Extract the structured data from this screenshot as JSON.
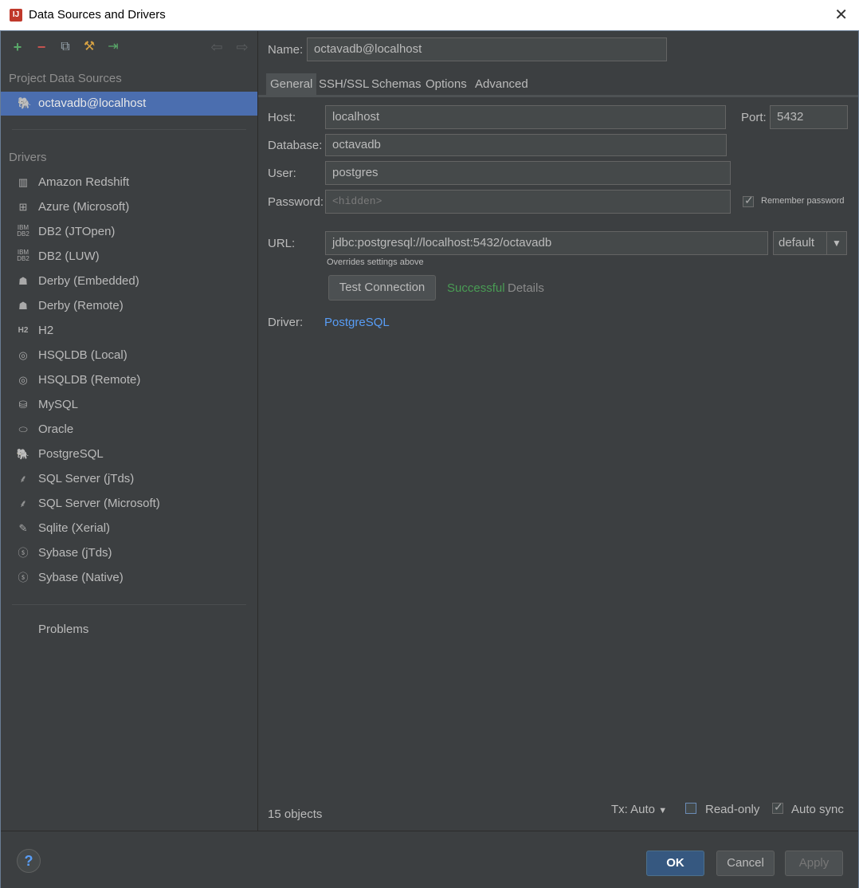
{
  "window": {
    "title": "Data Sources and Drivers"
  },
  "toolbar": {
    "icons": [
      "add-icon",
      "remove-icon",
      "duplicate-icon",
      "driver-properties-icon",
      "import-icon",
      "back-icon",
      "forward-icon"
    ]
  },
  "left": {
    "project_title": "Project Data Sources",
    "selected_source": "octavadb@localhost",
    "drivers_title": "Drivers",
    "drivers": [
      {
        "label": "Amazon Redshift",
        "icon": "redshift-icon"
      },
      {
        "label": "Azure (Microsoft)",
        "icon": "windows-icon"
      },
      {
        "label": "DB2 (JTOpen)",
        "icon": "ibm-db2-icon"
      },
      {
        "label": "DB2 (LUW)",
        "icon": "ibm-db2-icon"
      },
      {
        "label": "Derby (Embedded)",
        "icon": "derby-hat-icon"
      },
      {
        "label": "Derby (Remote)",
        "icon": "derby-hat-icon"
      },
      {
        "label": "H2",
        "icon": "h2-icon"
      },
      {
        "label": "HSQLDB (Local)",
        "icon": "hsqldb-icon"
      },
      {
        "label": "HSQLDB (Remote)",
        "icon": "hsqldb-icon"
      },
      {
        "label": "MySQL",
        "icon": "mysql-icon"
      },
      {
        "label": "Oracle",
        "icon": "oracle-icon"
      },
      {
        "label": "PostgreSQL",
        "icon": "postgresql-icon"
      },
      {
        "label": "SQL Server (jTds)",
        "icon": "sqlserver-icon"
      },
      {
        "label": "SQL Server (Microsoft)",
        "icon": "sqlserver-icon"
      },
      {
        "label": "Sqlite (Xerial)",
        "icon": "sqlite-icon"
      },
      {
        "label": "Sybase (jTds)",
        "icon": "sybase-icon"
      },
      {
        "label": "Sybase (Native)",
        "icon": "sybase-icon"
      }
    ],
    "problems": "Problems"
  },
  "form": {
    "name_label": "Name:",
    "name_value": "octavadb@localhost",
    "tabs": [
      "General",
      "SSH/SSL",
      "Schemas",
      "Options",
      "Advanced"
    ],
    "host_label": "Host:",
    "host_value": "localhost",
    "port_label": "Port:",
    "port_value": "5432",
    "database_label": "Database:",
    "database_value": "octavadb",
    "user_label": "User:",
    "user_value": "postgres",
    "password_label": "Password:",
    "password_placeholder": "<hidden>",
    "remember_password": "Remember password",
    "url_label": "URL:",
    "url_value": "jdbc:postgresql://localhost:5432/octavadb",
    "url_mode": "default",
    "url_hint": "Overrides settings above",
    "test_connection": "Test Connection",
    "status": "Successful",
    "details": "Details",
    "driver_label": "Driver:",
    "driver_value": "PostgreSQL",
    "objects": "15 objects",
    "tx": "Tx: Auto",
    "readonly": "Read-only",
    "autosync": "Auto sync"
  },
  "buttons": {
    "ok": "OK",
    "cancel": "Cancel",
    "apply": "Apply"
  },
  "colors": {
    "background": "#3c3f41",
    "selection": "#4b6eaf",
    "success": "#499c54",
    "link": "#589df6"
  }
}
